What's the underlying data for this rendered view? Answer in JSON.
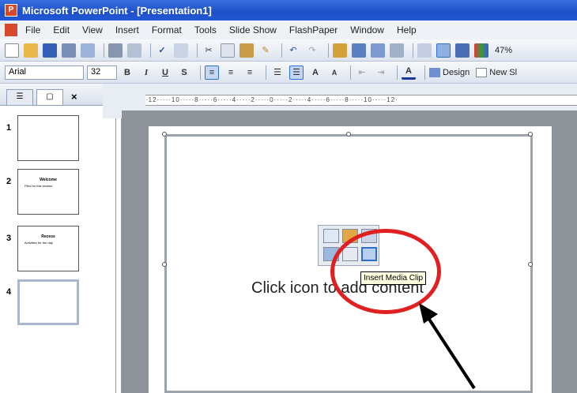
{
  "window": {
    "title": "Microsoft PowerPoint - [Presentation1]"
  },
  "menu": [
    "File",
    "Edit",
    "View",
    "Insert",
    "Format",
    "Tools",
    "Slide Show",
    "FlashPaper",
    "Window",
    "Help"
  ],
  "toolbar": {
    "zoom": "47%"
  },
  "formatting": {
    "font": "Arial",
    "size": "32",
    "bold": "B",
    "italic": "I",
    "underline": "U",
    "shadow": "S",
    "design_label": "Design",
    "new_slide_label": "New Sl"
  },
  "ruler": {
    "ticks": "·12·····10·····8·····6·····4·····2·····0·····2·····4·····6·····8·····10·····12·"
  },
  "slides": [
    {
      "num": "1",
      "title": "",
      "subtitle": ""
    },
    {
      "num": "2",
      "title": "Welcome",
      "subtitle": "Files for this section"
    },
    {
      "num": "3",
      "title": "Recess",
      "subtitle": "Activities for the day"
    },
    {
      "num": "4",
      "title": "",
      "subtitle": ""
    }
  ],
  "slide": {
    "prompt": "Click icon to add content"
  },
  "tooltip": "Insert Media Clip",
  "colors": {
    "titlebar": "#1c4fc8",
    "highlight_circle": "#e02020",
    "tooltip_bg": "#ffffe1"
  }
}
